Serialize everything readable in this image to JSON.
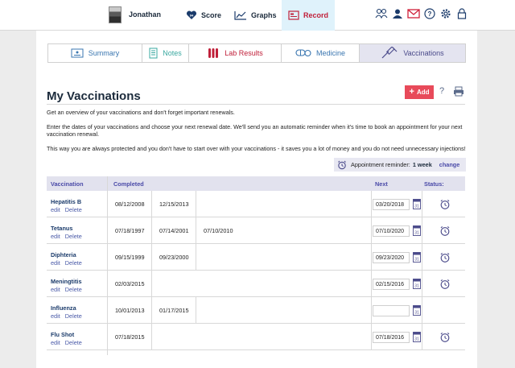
{
  "topbar": {
    "user_name": "Jonathan",
    "nav": [
      {
        "label": "Score",
        "icon": "heart-icon"
      },
      {
        "label": "Graphs",
        "icon": "line-chart-icon"
      },
      {
        "label": "Record",
        "icon": "record-icon",
        "active": true
      }
    ],
    "right_icons": [
      "family-icon",
      "profile-icon",
      "mail-icon",
      "help-icon",
      "settings-icon",
      "lock-icon"
    ],
    "accent": "#c0203a"
  },
  "tabs": [
    {
      "label": "Summary",
      "icon": "summary-icon"
    },
    {
      "label": "Notes",
      "icon": "notes-icon"
    },
    {
      "label": "Lab Results",
      "icon": "test-tubes-icon"
    },
    {
      "label": "Medicine",
      "icon": "pill-icon"
    },
    {
      "label": "Vaccinations",
      "icon": "syringe-icon",
      "active": true
    }
  ],
  "page": {
    "title": "My Vaccinations",
    "add_label": "Add",
    "help_label": "?",
    "desc1": "Get an overview of your vaccinations and don't forget important renewals.",
    "desc2": "Enter the dates of your vaccinations and choose your next renewal date. We'll send you an automatic reminder when it's time to book an appointment for your next vaccination renewal.",
    "desc3": "This way you are always protected and you don't have to start over with your vaccinations - it saves you a lot of money and you do not need unnecessary injections!"
  },
  "reminder": {
    "label": "Appointment reminder:",
    "value": "1 week",
    "change": "change"
  },
  "table": {
    "headers": {
      "vaccination": "Vaccination",
      "completed": "Completed",
      "next": "Next",
      "status": "Status:"
    },
    "edit_label": "edit",
    "delete_label": "Delete",
    "rows": [
      {
        "name": "Hepatitis B",
        "d1": "08/12/2008",
        "d2": "12/15/2013",
        "d3": "",
        "next": "03/20/2018",
        "status_icon": true
      },
      {
        "name": "Tetanus",
        "d1": "07/18/1997",
        "d2": "07/14/2001",
        "d3": "07/10/2010",
        "next": "07/10/2020",
        "status_icon": true
      },
      {
        "name": "Diphteria",
        "d1": "09/15/1999",
        "d2": "09/23/2000",
        "d3": "",
        "next": "09/23/2020",
        "status_icon": true
      },
      {
        "name": "Meningtitis",
        "d1": "02/03/2015",
        "d2": "",
        "d3": "",
        "next": "02/15/2016",
        "status_icon": true
      },
      {
        "name": "Influenza",
        "d1": "10/01/2013",
        "d2": "01/17/2015",
        "d3": "",
        "next": "",
        "status_icon": false
      },
      {
        "name": "Flu Shot",
        "d1": "07/18/2015",
        "d2": "",
        "d3": "",
        "next": "07/18/2016",
        "status_icon": true
      }
    ]
  }
}
